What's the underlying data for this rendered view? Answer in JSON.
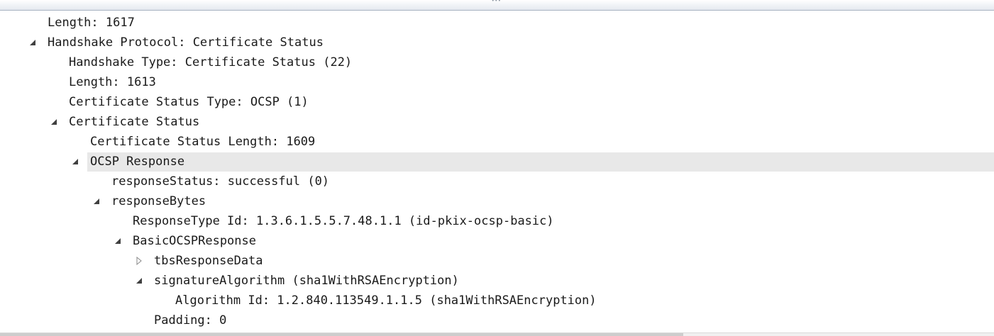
{
  "tree": {
    "rows": [
      {
        "label": "Length: 1617",
        "depth": 0,
        "toggle": "none"
      },
      {
        "label": "Handshake Protocol: Certificate Status",
        "depth": 0,
        "toggle": "expanded"
      },
      {
        "label": "Handshake Type: Certificate Status (22)",
        "depth": 1,
        "toggle": "none"
      },
      {
        "label": "Length: 1613",
        "depth": 1,
        "toggle": "none"
      },
      {
        "label": "Certificate Status Type: OCSP (1)",
        "depth": 1,
        "toggle": "none"
      },
      {
        "label": "Certificate Status",
        "depth": 1,
        "toggle": "expanded"
      },
      {
        "label": "Certificate Status Length: 1609",
        "depth": 2,
        "toggle": "none"
      },
      {
        "label": "OCSP Response",
        "depth": 2,
        "toggle": "expanded",
        "selected": true
      },
      {
        "label": "responseStatus: successful (0)",
        "depth": 3,
        "toggle": "none"
      },
      {
        "label": "responseBytes",
        "depth": 3,
        "toggle": "expanded"
      },
      {
        "label": "ResponseType Id: 1.3.6.1.5.5.7.48.1.1 (id-pkix-ocsp-basic)",
        "depth": 4,
        "toggle": "none"
      },
      {
        "label": "BasicOCSPResponse",
        "depth": 4,
        "toggle": "expanded"
      },
      {
        "label": "tbsResponseData",
        "depth": 5,
        "toggle": "collapsed"
      },
      {
        "label": "signatureAlgorithm (sha1WithRSAEncryption)",
        "depth": 5,
        "toggle": "expanded"
      },
      {
        "label": "Algorithm Id: 1.2.840.113549.1.1.5 (sha1WithRSAEncryption)",
        "depth": 6,
        "toggle": "none"
      },
      {
        "label": "Padding: 0",
        "depth": 5,
        "toggle": "none"
      }
    ]
  },
  "icons": {
    "expanded": "triangle-down-right-icon",
    "collapsed": "triangle-right-outline-icon",
    "splitter_grip": "grip-dots-icon"
  },
  "colors": {
    "selection": "#e8e8e8",
    "text": "#1a1a1a",
    "splitter_border": "#a9b3c2"
  }
}
